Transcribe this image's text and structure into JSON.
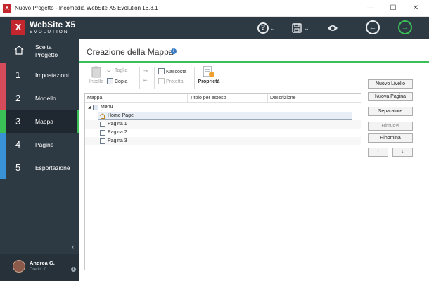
{
  "window": {
    "title": "Nuovo Progetto - Incomedia WebSite X5 Evolution 16.3.1",
    "controls": {
      "minimize": "—",
      "maximize": "☐",
      "close": "✕"
    }
  },
  "brand": {
    "line1": "WebSite X5",
    "line2": "EVOLUTION",
    "accent": "#c4262e"
  },
  "toolbar": {
    "help_icon": "?",
    "save_icon": "💾",
    "preview_icon": "👁",
    "dropdown_chevron": "⌄",
    "back_icon": "←",
    "forward_icon": "→"
  },
  "sidebar": {
    "home_label": "Scelta Progetto",
    "items": [
      {
        "num": "1",
        "label": "Impostazioni",
        "color": "#d64b5a"
      },
      {
        "num": "2",
        "label": "Modello",
        "color": "#d64b5a"
      },
      {
        "num": "3",
        "label": "Mappa",
        "color": "#3bbf57"
      },
      {
        "num": "4",
        "label": "Pagine",
        "color": "#3a92d6"
      },
      {
        "num": "5",
        "label": "Esportazione",
        "color": "#3a92d6"
      }
    ],
    "collapse_icon": "‹"
  },
  "user": {
    "name": "Andrea G.",
    "credit": "Crediti: 0",
    "info_icon": "i"
  },
  "page": {
    "title": "Creazione della Mappa",
    "help_icon": "i"
  },
  "ribbon": {
    "paste": "Incolla",
    "cut": "Taglia",
    "copy": "Copia",
    "hidden": "Nascosta",
    "protected": "Protetta",
    "properties": "Proprietà"
  },
  "tree": {
    "columns": [
      "Mappa",
      "Titolo per esteso",
      "Descrizione"
    ],
    "root": "Menu",
    "toggle": "◢",
    "nodes": [
      "Home Page",
      "Pagina 1",
      "Pagina 2",
      "Pagina 3"
    ]
  },
  "buttons": {
    "new_level": "Nuovo Livello",
    "new_page": "Nuova Pagina",
    "separator": "Separatore",
    "remove": "Rimuovi",
    "rename": "Rinomina",
    "move_up": "↑",
    "move_down": "↓"
  },
  "colors": {
    "sidebar_bg": "#2d3943",
    "accent_green": "#3bbf57"
  }
}
